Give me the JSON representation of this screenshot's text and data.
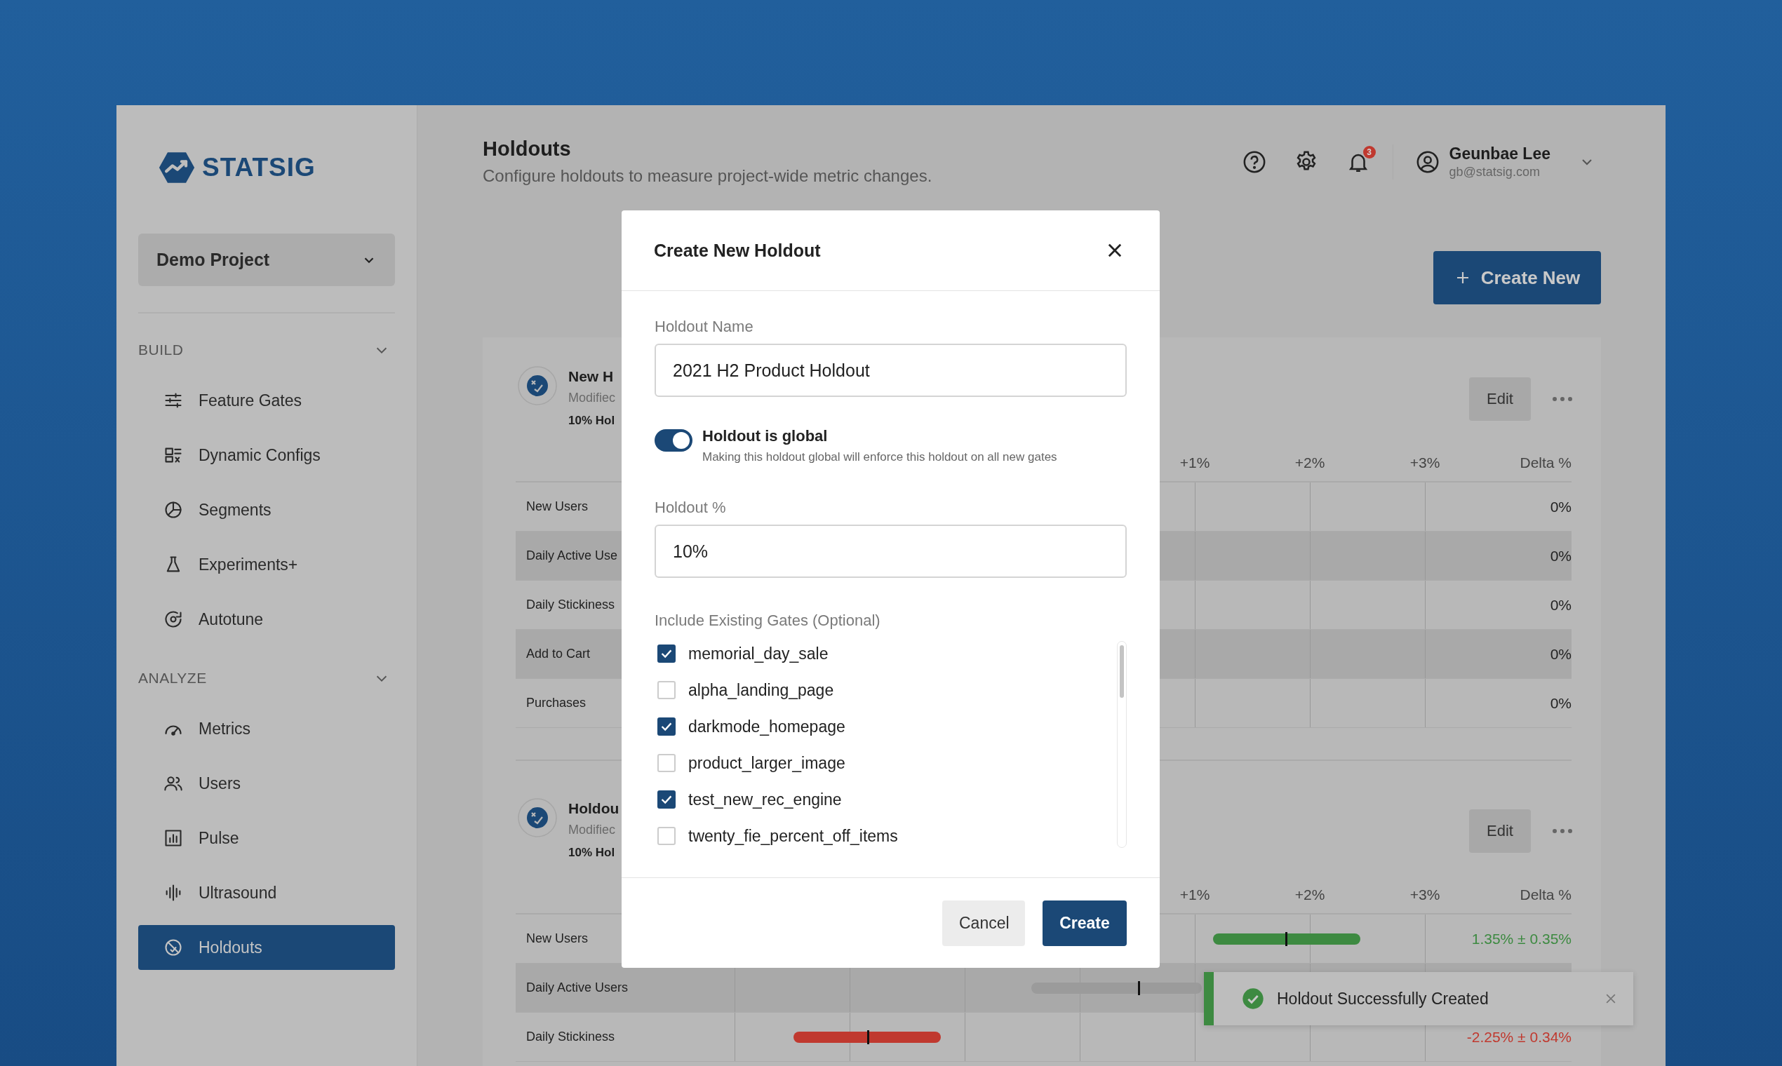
{
  "sidebar": {
    "logo": "STATSIG",
    "project": "Demo Project",
    "sections": [
      {
        "title": "BUILD",
        "expanded": true,
        "items": [
          {
            "label": "Feature Gates",
            "selected": false
          },
          {
            "label": "Dynamic Configs",
            "selected": false
          },
          {
            "label": "Segments",
            "selected": false
          },
          {
            "label": "Experiments+",
            "selected": false
          },
          {
            "label": "Autotune",
            "selected": false
          }
        ]
      },
      {
        "title": "ANALYZE",
        "expanded": true,
        "items": [
          {
            "label": "Metrics",
            "selected": false
          },
          {
            "label": "Users",
            "selected": false
          },
          {
            "label": "Pulse",
            "selected": false
          },
          {
            "label": "Ultrasound",
            "selected": false
          },
          {
            "label": "Holdouts",
            "selected": true
          }
        ]
      }
    ]
  },
  "header": {
    "title": "Holdouts",
    "subtitle": "Configure holdouts to measure project-wide metric changes.",
    "notification_count": "3",
    "user_name": "Geunbae Lee",
    "user_email": "gb@statsig.com"
  },
  "create_button": "Create New",
  "holdouts": [
    {
      "name": "New H",
      "modified": "Modifiec",
      "summary": "10% Hol",
      "edit": "Edit",
      "axis": [
        "+1%",
        "+2%",
        "+3%"
      ],
      "delta_heading": "Delta %",
      "metrics": [
        {
          "name": "New Users",
          "delta": "0%"
        },
        {
          "name": "Daily Active Use",
          "delta": "0%"
        },
        {
          "name": "Daily Stickiness",
          "delta": "0%"
        },
        {
          "name": "Add to Cart",
          "delta": "0%"
        },
        {
          "name": "Purchases",
          "delta": "0%"
        }
      ]
    },
    {
      "name": "Holdou",
      "modified": "Modifiec",
      "summary": "10% Hol",
      "edit": "Edit",
      "axis": [
        "+1%",
        "+2%",
        "+3%"
      ],
      "delta_heading": "Delta %",
      "metrics": [
        {
          "name": "New Users",
          "delta": "1.35% ± 0.35%",
          "color": "#3d8a41"
        },
        {
          "name": "Daily Active Users",
          "color": "#9b9b9b"
        },
        {
          "name": "Daily Stickiness",
          "delta": "-2.25% ± 0.34%",
          "color": "#c0392f"
        }
      ]
    }
  ],
  "modal": {
    "title": "Create New Holdout",
    "name_label": "Holdout Name",
    "name_value": "2021 H2 Product Holdout",
    "toggle": {
      "label": "Holdout is global",
      "description": "Making this holdout global will enforce this holdout on all new gates",
      "on": true
    },
    "percent_label": "Holdout %",
    "percent_value": "10%",
    "gates_label": "Include Existing Gates (Optional)",
    "gates": [
      {
        "label": "memorial_day_sale",
        "checked": true
      },
      {
        "label": "alpha_landing_page",
        "checked": false
      },
      {
        "label": "darkmode_homepage",
        "checked": true
      },
      {
        "label": "product_larger_image",
        "checked": false
      },
      {
        "label": "test_new_rec_engine",
        "checked": true
      },
      {
        "label": "twenty_fie_percent_off_items",
        "checked": false
      }
    ],
    "buttons": [
      {
        "label": "Cancel",
        "kind": "secondary"
      },
      {
        "label": "Create",
        "kind": "primary"
      }
    ]
  },
  "toast": {
    "kind": "success",
    "text": "Holdout Successfully Created"
  }
}
